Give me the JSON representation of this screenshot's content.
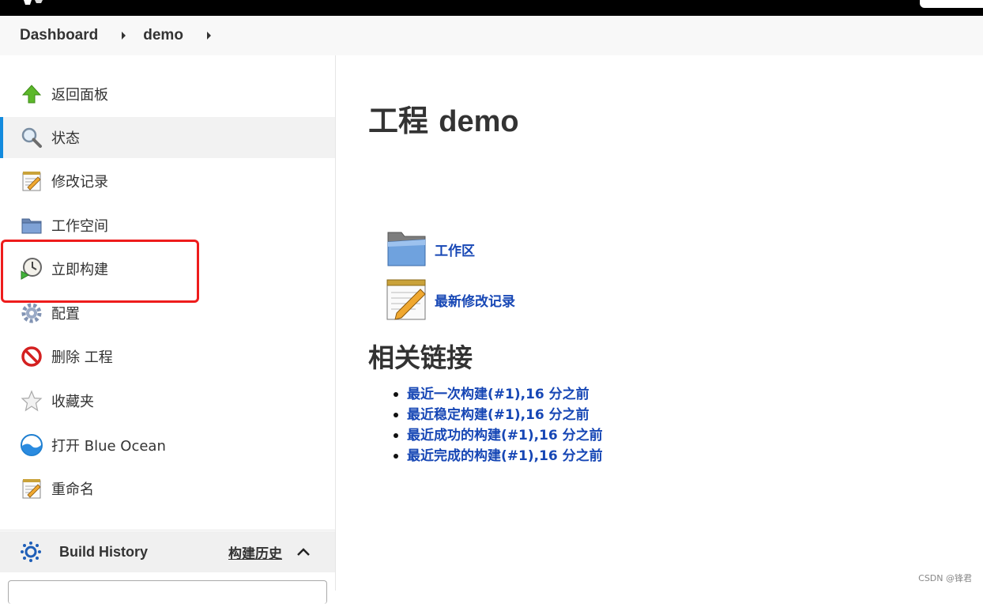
{
  "breadcrumb": {
    "items": [
      "Dashboard",
      "demo"
    ]
  },
  "sidebar": {
    "tasks": [
      {
        "label": "返回面板",
        "icon": "up-arrow-icon"
      },
      {
        "label": "状态",
        "icon": "magnifier-icon",
        "active": true
      },
      {
        "label": "修改记录",
        "icon": "notepad-icon"
      },
      {
        "label": "工作空间",
        "icon": "folder-icon"
      },
      {
        "label": "立即构建",
        "icon": "clock-play-icon",
        "highlighted": true
      },
      {
        "label": "配置",
        "icon": "gear-icon"
      },
      {
        "label": "删除 工程",
        "icon": "no-entry-icon"
      },
      {
        "label": "收藏夹",
        "icon": "star-icon"
      },
      {
        "label": "打开 Blue Ocean",
        "icon": "blue-ocean-icon"
      },
      {
        "label": "重命名",
        "icon": "notepad-icon"
      }
    ],
    "build_history": {
      "title": "Build History",
      "link": "构建历史"
    }
  },
  "main": {
    "title_prefix": "工程",
    "title_name": "demo",
    "big_links": [
      {
        "label": "工作区",
        "icon": "large-folder-icon"
      },
      {
        "label": "最新修改记录",
        "icon": "large-notepad-icon"
      }
    ],
    "related_title": "相关链接",
    "permalinks": [
      "最近一次构建(#1),16 分之前",
      "最近稳定构建(#1),16 分之前",
      "最近成功的构建(#1),16 分之前",
      "最近完成的构建(#1),16 分之前"
    ]
  },
  "watermark": "CSDN @锋君",
  "colors": {
    "accent": "#138bde",
    "link": "#1747b5",
    "highlight_box": "#ee1c1c"
  }
}
